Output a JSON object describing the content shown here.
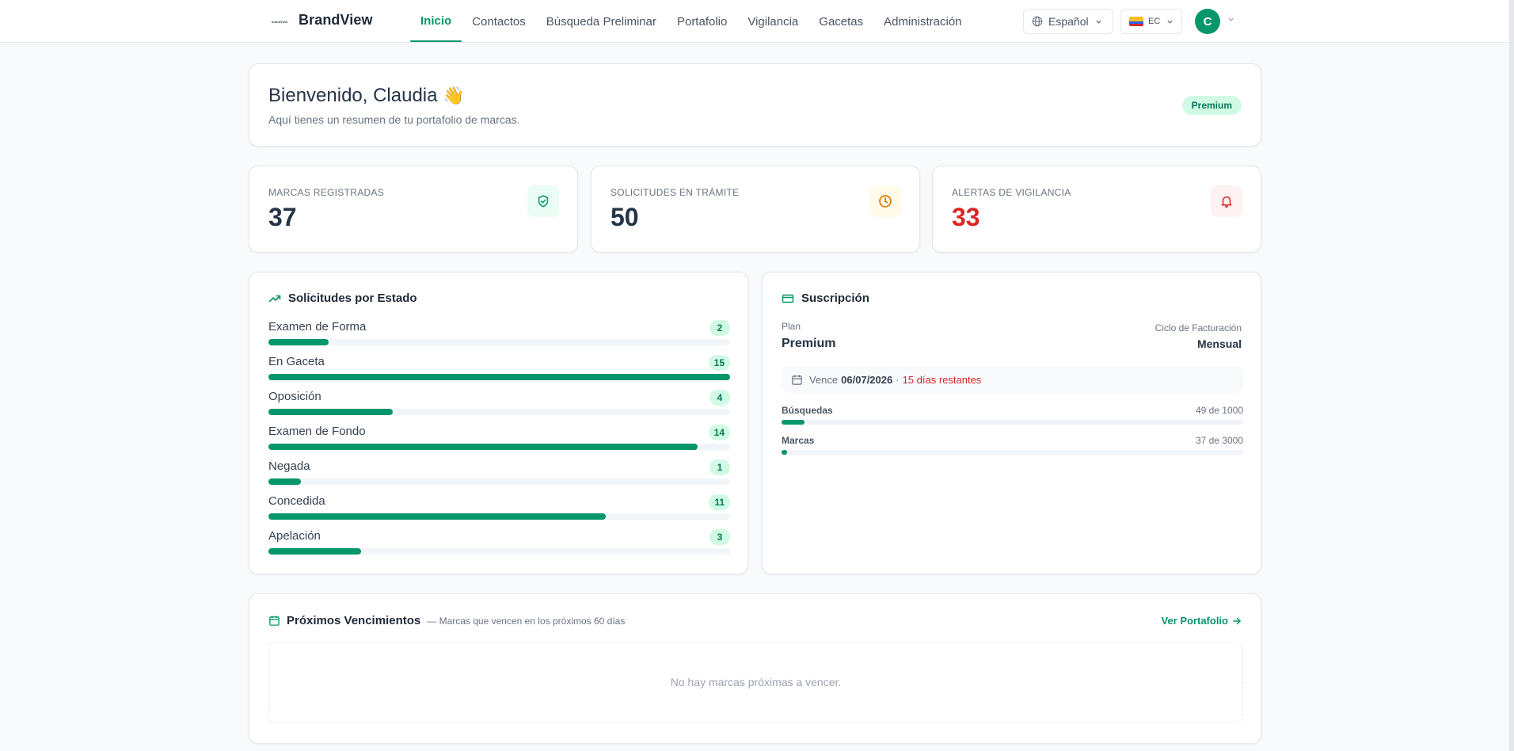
{
  "header": {
    "brand": "BrandView",
    "logo_text": "brandView",
    "nav": [
      {
        "label": "Inicio",
        "active": true
      },
      {
        "label": "Contactos"
      },
      {
        "label": "Búsqueda Preliminar"
      },
      {
        "label": "Portafolio"
      },
      {
        "label": "Vigilancia"
      },
      {
        "label": "Gacetas"
      },
      {
        "label": "Administración"
      }
    ],
    "language": "Español",
    "country": "EC",
    "avatar_initial": "C"
  },
  "welcome": {
    "title": "Bienvenido, Claudia",
    "emoji": "👋",
    "subtitle": "Aquí tienes un resumen de tu portafolio de marcas.",
    "plan_badge": "Premium"
  },
  "stats": [
    {
      "label": "MARCAS REGISTRADAS",
      "value": "37",
      "icon": "shield-check-icon",
      "color": "#059669"
    },
    {
      "label": "SOLICITUDES EN TRÁMITE",
      "value": "50",
      "icon": "clock-icon",
      "color": "#d97706"
    },
    {
      "label": "ALERTAS DE VIGILANCIA",
      "value": "33",
      "icon": "bell-icon",
      "color": "#dc2626"
    }
  ],
  "status": {
    "title": "Solicitudes por Estado",
    "items": [
      {
        "name": "Examen de Forma",
        "count": "2",
        "fill": 0.13
      },
      {
        "name": "En Gaceta",
        "count": "15",
        "fill": 1.0
      },
      {
        "name": "Oposición",
        "count": "4",
        "fill": 0.27
      },
      {
        "name": "Examen de Fondo",
        "count": "14",
        "fill": 0.93
      },
      {
        "name": "Negada",
        "count": "1",
        "fill": 0.07
      },
      {
        "name": "Concedida",
        "count": "11",
        "fill": 0.73
      },
      {
        "name": "Apelación",
        "count": "3",
        "fill": 0.2
      }
    ]
  },
  "subscription": {
    "title": "Suscripción",
    "plan_label": "Plan",
    "plan_value": "Premium",
    "cycle_label": "Ciclo de Facturación",
    "cycle_value": "Mensual",
    "expiry_prefix": "Vence",
    "expiry_date": "06/07/2026",
    "expiry_sep": "·",
    "expiry_remaining": "15 días restantes",
    "usage": [
      {
        "name": "Búsquedas",
        "value": "49 de 1000",
        "fill": 0.049
      },
      {
        "name": "Marcas",
        "value": "37 de 3000",
        "fill": 0.012
      }
    ]
  },
  "upcoming": {
    "title": "Próximos Vencimientos",
    "subtitle": "— Marcas que vencen en los próximos 60 días",
    "link": "Ver Portafolio",
    "empty": "No hay marcas próximas a vencer."
  },
  "colors": {
    "accent": "#059669",
    "danger": "#dc2626",
    "warning": "#d97706"
  }
}
